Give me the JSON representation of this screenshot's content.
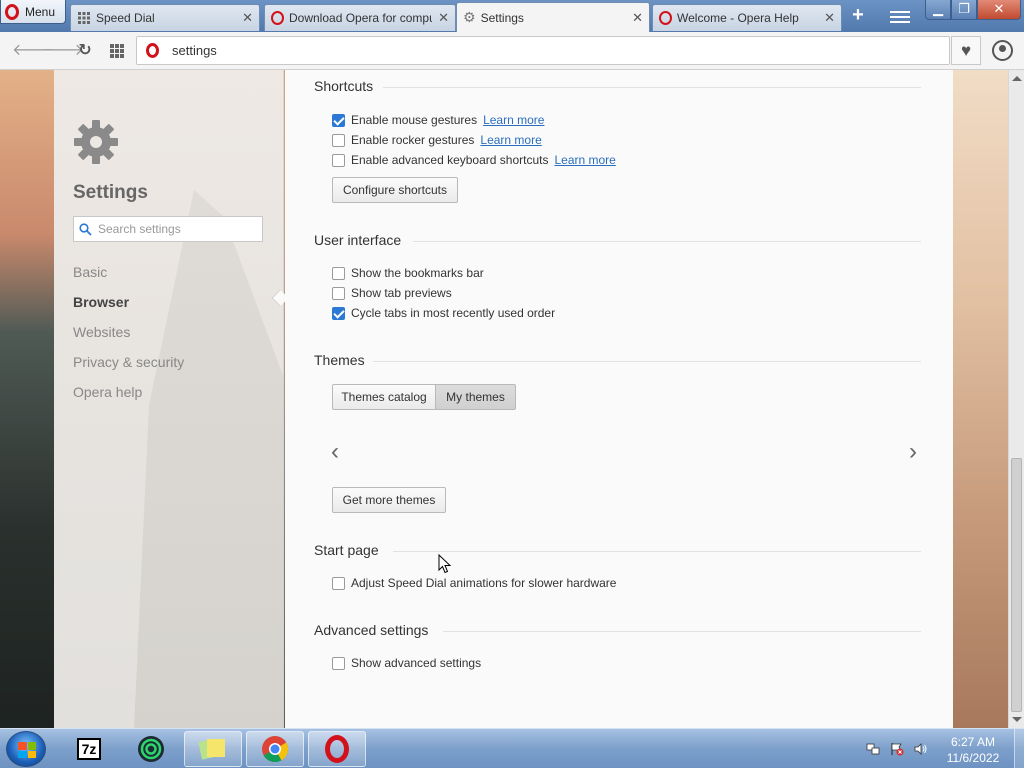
{
  "browser": {
    "menu_label": "Menu",
    "tabs": [
      {
        "label": "Speed Dial",
        "icon": "grid-icon"
      },
      {
        "label": "Download Opera for computer",
        "icon": "opera-icon"
      },
      {
        "label": "Settings",
        "icon": "gear-icon"
      },
      {
        "label": "Welcome - Opera Help",
        "icon": "opera-icon"
      }
    ],
    "address": "settings"
  },
  "sidebar": {
    "title": "Settings",
    "search_placeholder": "Search settings",
    "items": [
      {
        "label": "Basic"
      },
      {
        "label": "Browser"
      },
      {
        "label": "Websites"
      },
      {
        "label": "Privacy & security"
      },
      {
        "label": "Opera help"
      }
    ]
  },
  "sections": {
    "shortcuts": {
      "title": "Shortcuts",
      "options": [
        {
          "label": "Enable mouse gestures",
          "link": "Learn more",
          "checked": true
        },
        {
          "label": "Enable rocker gestures",
          "link": "Learn more",
          "checked": false
        },
        {
          "label": "Enable advanced keyboard shortcuts",
          "link": "Learn more",
          "checked": false
        }
      ],
      "button": "Configure shortcuts"
    },
    "ui": {
      "title": "User interface",
      "options": [
        {
          "label": "Show the bookmarks bar",
          "checked": false
        },
        {
          "label": "Show tab previews",
          "checked": false
        },
        {
          "label": "Cycle tabs in most recently used order",
          "checked": true
        }
      ]
    },
    "themes": {
      "title": "Themes",
      "tab_catalog": "Themes catalog",
      "tab_mine": "My themes",
      "button": "Get more themes"
    },
    "start_page": {
      "title": "Start page",
      "options": [
        {
          "label": "Adjust Speed Dial animations for slower hardware",
          "checked": false
        }
      ]
    },
    "advanced": {
      "title": "Advanced settings",
      "options": [
        {
          "label": "Show advanced settings",
          "checked": false
        }
      ]
    }
  },
  "taskbar": {
    "time": "6:27 AM",
    "date": "11/6/2022",
    "sevenzip_label": "7z"
  }
}
